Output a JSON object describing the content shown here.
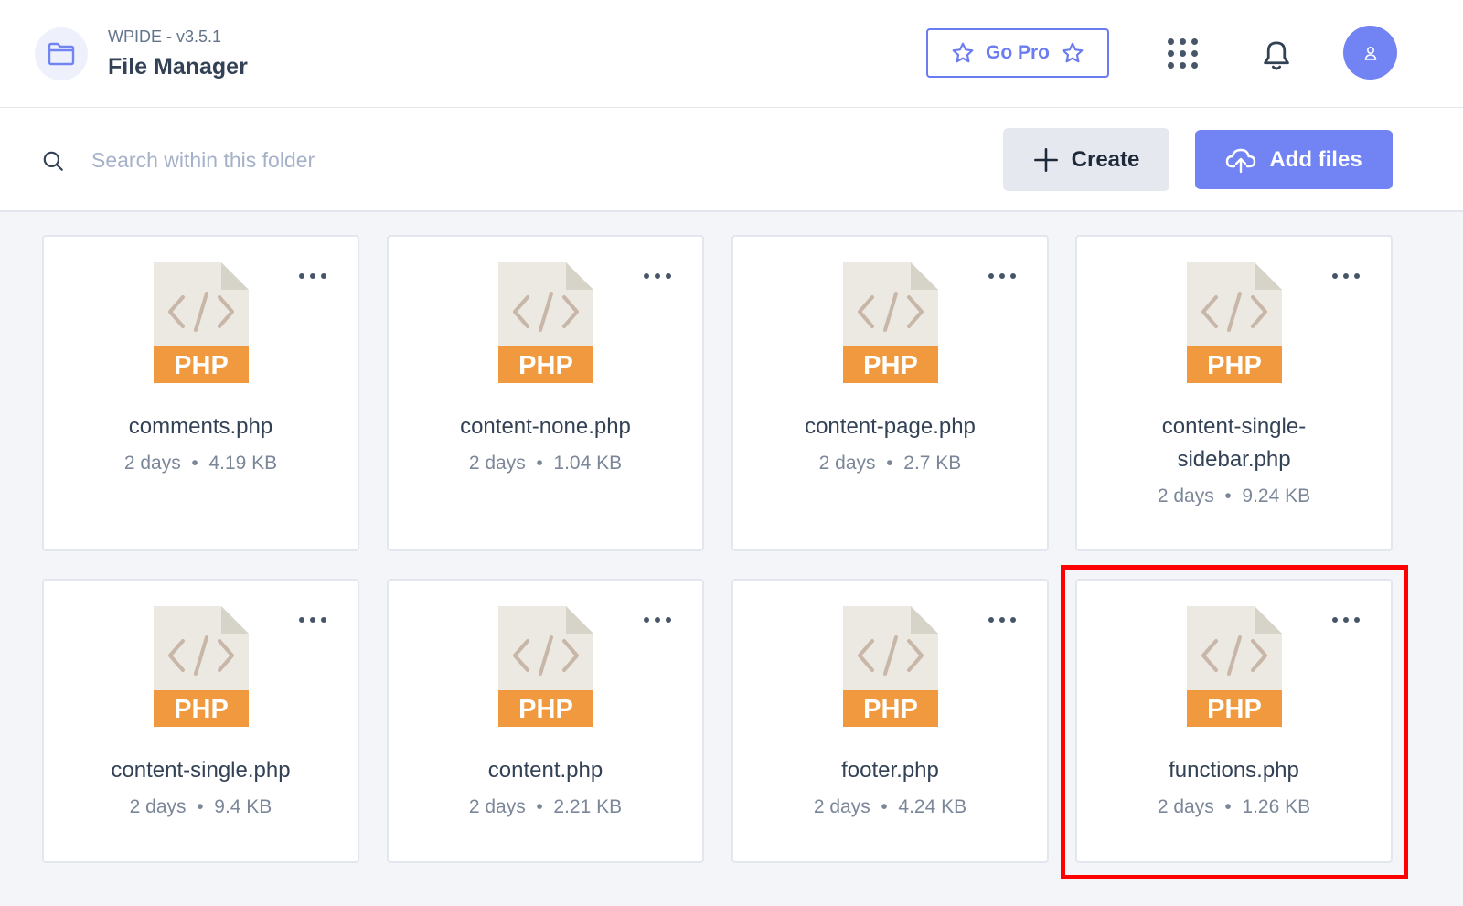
{
  "header": {
    "version": "WPIDE - v3.5.1",
    "title": "File Manager",
    "go_pro_label": "Go Pro"
  },
  "toolbar": {
    "search_placeholder": "Search within this folder",
    "create_label": "Create",
    "add_files_label": "Add files"
  },
  "files": [
    {
      "name": "comments.php",
      "age": "2 days",
      "size": "4.19 KB"
    },
    {
      "name": "content-none.php",
      "age": "2 days",
      "size": "1.04 KB"
    },
    {
      "name": "content-page.php",
      "age": "2 days",
      "size": "2.7 KB"
    },
    {
      "name": "content-single-sidebar.php",
      "name_line1": "content-single-",
      "name_line2": "sidebar.php",
      "age": "2 days",
      "size": "9.24 KB"
    },
    {
      "name": "content-single.php",
      "age": "2 days",
      "size": "9.4 KB"
    },
    {
      "name": "content.php",
      "age": "2 days",
      "size": "2.21 KB"
    },
    {
      "name": "footer.php",
      "age": "2 days",
      "size": "4.24 KB"
    },
    {
      "name": "functions.php",
      "age": "2 days",
      "size": "1.26 KB",
      "highlighted": true
    }
  ],
  "file_icon": {
    "label": "PHP",
    "icon": "php-file-icon"
  },
  "colors": {
    "accent": "#7284f3",
    "php_badge": "#f0993e",
    "highlight": "#ff0000"
  }
}
